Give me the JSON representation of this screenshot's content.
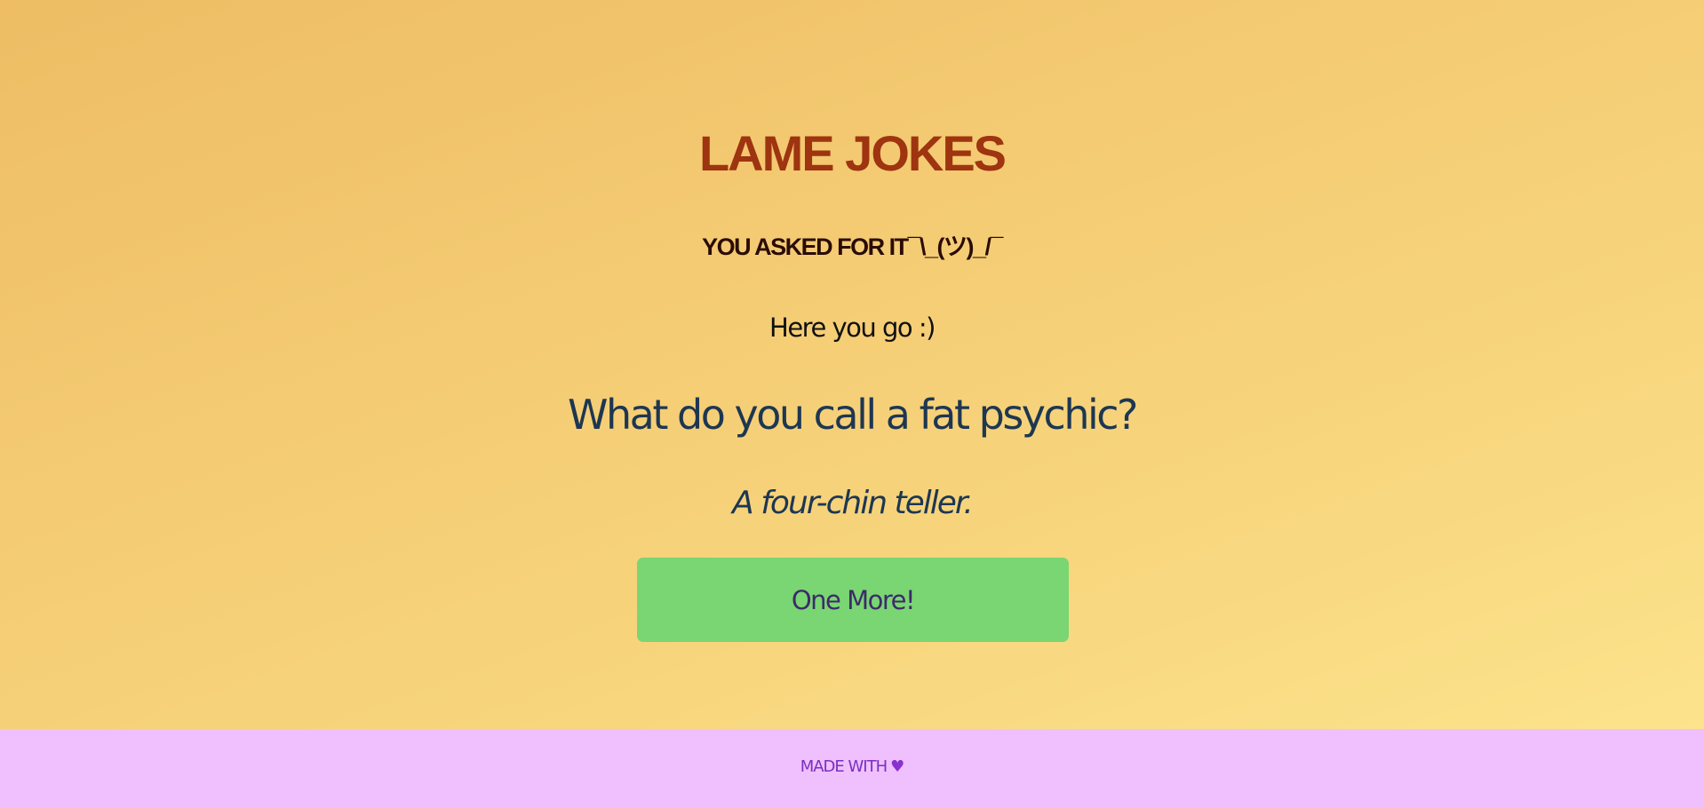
{
  "header": {
    "title": "LAME JOKES",
    "subtitle": "YOU ASKED FOR IT¯\\_(ツ)_/¯"
  },
  "joke": {
    "intro": "Here you go :)",
    "question": "What do you call a fat psychic?",
    "answer": "A four-chin teller."
  },
  "actions": {
    "more_label": "One More!"
  },
  "footer": {
    "text": "MADE WITH",
    "icon": "heart-icon",
    "heart_color": "#8a2fd0"
  },
  "colors": {
    "title": "#9e3410",
    "button": "#79d672",
    "footer_bg": "#efc0fd"
  }
}
